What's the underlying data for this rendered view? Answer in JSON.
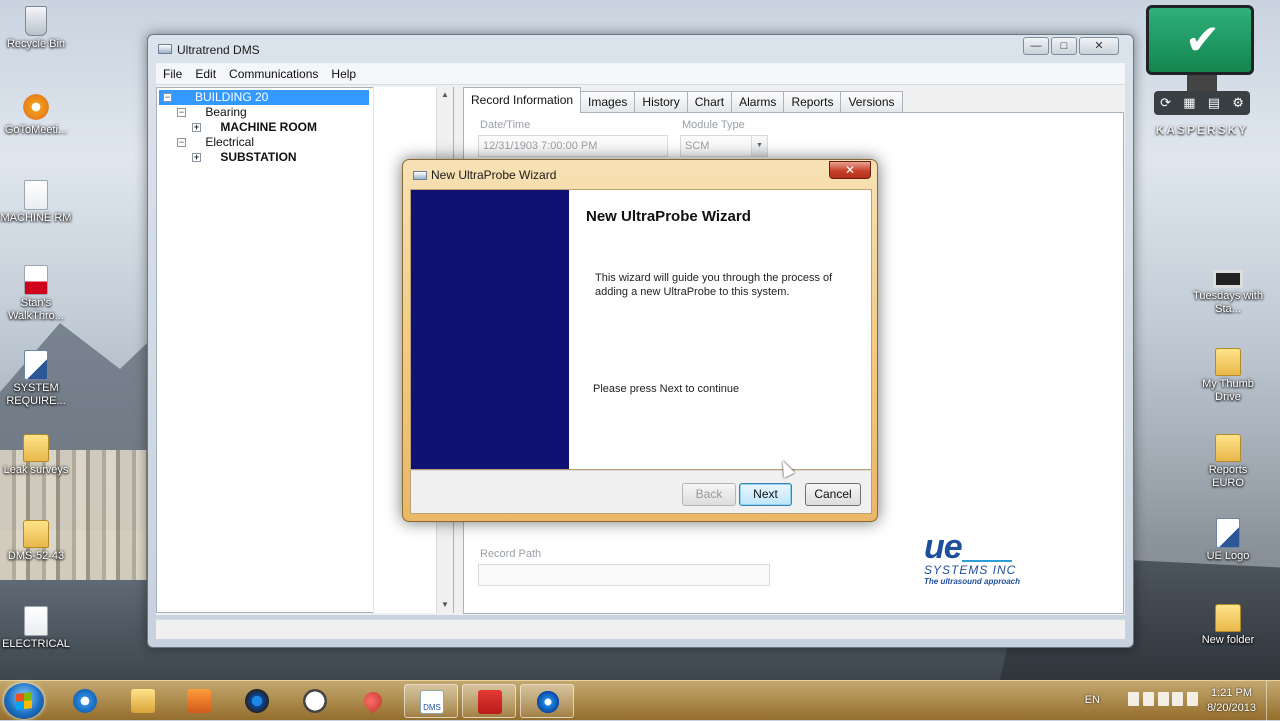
{
  "desktop": {
    "left_icons": [
      {
        "label": "Recycle Bin",
        "icon": "recycle-bin-icon"
      },
      {
        "label": "GoToMeeti...",
        "icon": "gotomeeting-icon"
      },
      {
        "label": "MACHINE RM",
        "icon": "document-icon"
      },
      {
        "label": "Stan's WalkThro...",
        "icon": "pdf-icon"
      },
      {
        "label": "SYSTEM REQUIRE...",
        "icon": "word-document-icon"
      },
      {
        "label": "Leak surveys",
        "icon": "folder-icon"
      },
      {
        "label": "DMS-52-43",
        "icon": "folder-icon"
      },
      {
        "label": "ELECTRICAL",
        "icon": "document-icon"
      }
    ],
    "right_icons": [
      {
        "label": "Tuesdays with Sta...",
        "icon": "video-icon"
      },
      {
        "label": "My Thumb Drive",
        "icon": "folder-icon"
      },
      {
        "label": "Reports EURO",
        "icon": "folder-icon"
      },
      {
        "label": "UE Logo",
        "icon": "word-document-icon"
      },
      {
        "label": "New folder",
        "icon": "folder-icon"
      }
    ]
  },
  "gadget": {
    "brand": "KASPERSKY",
    "status_icon": "checkmark-icon"
  },
  "app": {
    "title": "Ultratrend DMS",
    "controls": {
      "minimize": "—",
      "maximize": "□",
      "close": "✕"
    },
    "menu": [
      "File",
      "Edit",
      "Communications",
      "Help"
    ],
    "tree": {
      "root": "BUILDING 20",
      "nodes": [
        {
          "label": "Bearing"
        },
        {
          "label": "MACHINE ROOM"
        },
        {
          "label": "Electrical"
        },
        {
          "label": "SUBSTATION"
        }
      ],
      "toggles": {
        "collapse": "−",
        "expand": "+"
      }
    },
    "scroll": {
      "up": "▲",
      "down": "▼"
    },
    "tabs": [
      "Record Information",
      "Images",
      "History",
      "Chart",
      "Alarms",
      "Reports",
      "Versions"
    ],
    "active_tab": "Record Information",
    "fields": {
      "datetime_label": "Date/Time",
      "datetime_value": "12/31/1903  7:00:00 PM",
      "module_label": "Module Type",
      "module_value": "SCM",
      "record_path_label": "Record Path",
      "record_path_value": ""
    },
    "logo": {
      "main": "ue",
      "company": "SYSTEMS INC",
      "tagline": "The ultrasound approach"
    }
  },
  "dialog": {
    "title": "New UltraProbe Wizard",
    "close": "✕",
    "heading": "New UltraProbe Wizard",
    "description": "This wizard will guide you through the process of adding a new UltraProbe to this system.",
    "continue_text": "Please press Next to continue",
    "buttons": {
      "back": "Back",
      "next": "Next",
      "cancel": "Cancel"
    },
    "back_enabled": false
  },
  "taskbar": {
    "pinned": [
      "internet-explorer-icon",
      "windows-explorer-icon",
      "media-player-icon",
      "settings-gear-icon",
      "clock-icon",
      "pin-icon",
      "ue-dms-icon",
      "acrobat-icon",
      "flower-app-icon"
    ],
    "dms_label": "DMS",
    "language": "EN",
    "time": "1:21 PM",
    "date": "8/20/2013"
  }
}
